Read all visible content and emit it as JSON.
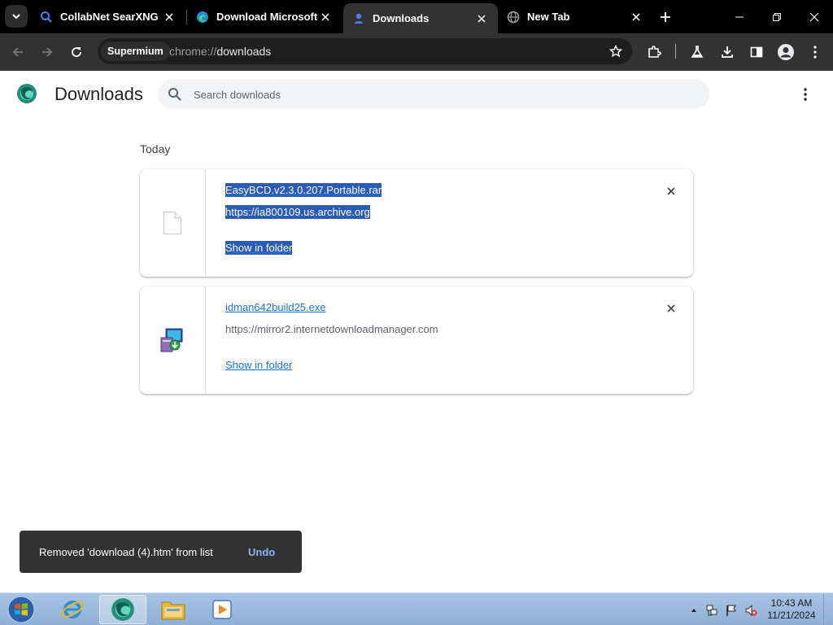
{
  "tabs": [
    {
      "title": "CollabNet SearXNG",
      "icon": "search-icon",
      "active": false
    },
    {
      "title": "Download Microsoft E",
      "icon": "edge-icon",
      "active": false
    },
    {
      "title": "Downloads",
      "icon": "download-icon",
      "active": true
    },
    {
      "title": "New Tab",
      "icon": "globe-icon",
      "active": false
    }
  ],
  "omnibox": {
    "chip": "Supermium",
    "url_scheme": "chrome://",
    "url_host": "downloads"
  },
  "page": {
    "title": "Downloads",
    "search_placeholder": "Search downloads",
    "date_header": "Today"
  },
  "downloads": [
    {
      "file_name": "EasyBCD.v2.3.0.207.Portable.rar",
      "url": "https://ia800109.us.archive.org",
      "action": "Show in folder",
      "icon": "generic-file-icon",
      "selected": true
    },
    {
      "file_name": "idman642build25.exe",
      "url": "https://mirror2.internetdownloadmanager.com",
      "action": "Show in folder",
      "icon": "installer-icon",
      "selected": false
    }
  ],
  "toast": {
    "message": "Removed 'download (4).htm' from list",
    "undo": "Undo"
  },
  "taskbar": {
    "apps": [
      "internet-explorer-icon",
      "edge-icon",
      "file-explorer-icon",
      "media-player-icon"
    ],
    "time": "10:43 AM",
    "date": "11/21/2024"
  },
  "colors": {
    "link": "#1a73e8",
    "selection": "#2a5bb6",
    "toolbar": "#323232",
    "tabstrip": "#000000",
    "toast_action": "#8ab4f8"
  }
}
